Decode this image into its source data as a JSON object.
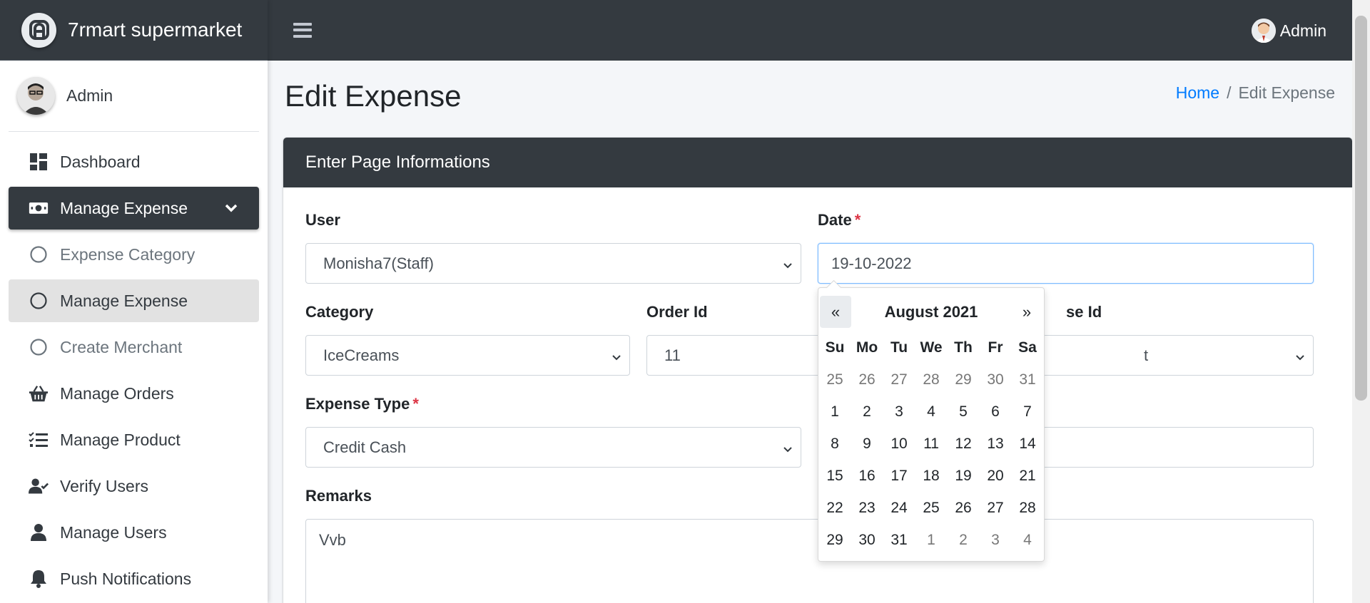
{
  "brand": {
    "name": "7rmart supermarket"
  },
  "sidebar": {
    "user_name": "Admin",
    "items": [
      {
        "label": "Dashboard",
        "icon": "dashboard-icon"
      },
      {
        "label": "Manage Expense",
        "icon": "money-bill-icon"
      },
      {
        "label": "Expense Category",
        "icon": "circle-icon"
      },
      {
        "label": "Manage Expense",
        "icon": "circle-icon"
      },
      {
        "label": "Create Merchant",
        "icon": "circle-icon"
      },
      {
        "label": "Manage Orders",
        "icon": "basket-icon"
      },
      {
        "label": "Manage Product",
        "icon": "tasks-icon"
      },
      {
        "label": "Verify Users",
        "icon": "user-check-icon"
      },
      {
        "label": "Manage Users",
        "icon": "user-icon"
      },
      {
        "label": "Push Notifications",
        "icon": "bell-icon"
      }
    ]
  },
  "topbar": {
    "user_name": "Admin"
  },
  "page": {
    "title": "Edit Expense",
    "breadcrumb": {
      "home": "Home",
      "separator": "/",
      "current": "Edit Expense"
    }
  },
  "card": {
    "header": "Enter Page Informations"
  },
  "form": {
    "user": {
      "label": "User",
      "value": "Monisha7(Staff)"
    },
    "date": {
      "label": "Date",
      "required": "*",
      "value": "19-10-2022"
    },
    "category": {
      "label": "Category",
      "value": "IceCreams"
    },
    "order_id": {
      "label": "Order Id",
      "value": "11"
    },
    "purchase_id": {
      "label_partial": "se Id",
      "value_partial": "t"
    },
    "expense_type": {
      "label": "Expense Type",
      "required": "*",
      "value": "Credit Cash"
    },
    "remarks": {
      "label": "Remarks",
      "value": "Vvb"
    }
  },
  "datepicker": {
    "prev": "«",
    "next": "»",
    "month_title": "August 2021",
    "weekdays": [
      "Su",
      "Mo",
      "Tu",
      "We",
      "Th",
      "Fr",
      "Sa"
    ],
    "weeks": [
      [
        {
          "d": "25",
          "o": true
        },
        {
          "d": "26",
          "o": true
        },
        {
          "d": "27",
          "o": true
        },
        {
          "d": "28",
          "o": true
        },
        {
          "d": "29",
          "o": true
        },
        {
          "d": "30",
          "o": true
        },
        {
          "d": "31",
          "o": true
        }
      ],
      [
        {
          "d": "1"
        },
        {
          "d": "2"
        },
        {
          "d": "3"
        },
        {
          "d": "4"
        },
        {
          "d": "5"
        },
        {
          "d": "6"
        },
        {
          "d": "7"
        }
      ],
      [
        {
          "d": "8"
        },
        {
          "d": "9"
        },
        {
          "d": "10"
        },
        {
          "d": "11"
        },
        {
          "d": "12"
        },
        {
          "d": "13"
        },
        {
          "d": "14"
        }
      ],
      [
        {
          "d": "15"
        },
        {
          "d": "16"
        },
        {
          "d": "17"
        },
        {
          "d": "18"
        },
        {
          "d": "19"
        },
        {
          "d": "20"
        },
        {
          "d": "21"
        }
      ],
      [
        {
          "d": "22"
        },
        {
          "d": "23"
        },
        {
          "d": "24"
        },
        {
          "d": "25"
        },
        {
          "d": "26"
        },
        {
          "d": "27"
        },
        {
          "d": "28"
        }
      ],
      [
        {
          "d": "29"
        },
        {
          "d": "30"
        },
        {
          "d": "31"
        },
        {
          "d": "1",
          "o": true
        },
        {
          "d": "2",
          "o": true
        },
        {
          "d": "3",
          "o": true
        },
        {
          "d": "4",
          "o": true
        }
      ]
    ]
  },
  "colors": {
    "dark": "#343a40",
    "link": "#007bff",
    "required": "#dc3545",
    "active_sub": "#e2e2e2"
  }
}
